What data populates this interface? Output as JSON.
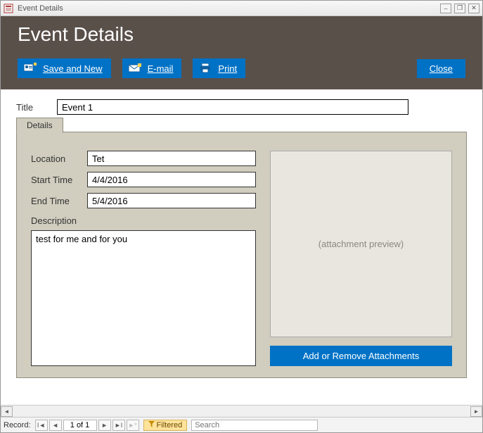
{
  "window": {
    "title": "Event Details",
    "controls": {
      "minimize": "–",
      "restore": "❐",
      "close": "✕"
    }
  },
  "header": {
    "heading": "Event Details",
    "buttons": {
      "save_and_new": "Save and New",
      "email": "E-mail",
      "print": "Print",
      "close": "Close"
    }
  },
  "form": {
    "title_label": "Title",
    "title_value": "Event 1",
    "tab_label": "Details",
    "location_label": "Location",
    "location_value": "Tet",
    "start_time_label": "Start Time",
    "start_time_value": "4/4/2016",
    "end_time_label": "End Time",
    "end_time_value": "5/4/2016",
    "description_label": "Description",
    "description_value": "test for me and for you",
    "attachment_preview_text": "(attachment preview)",
    "attachment_button": "Add or Remove Attachments"
  },
  "recordnav": {
    "label": "Record:",
    "position": "1 of 1",
    "filtered_label": "Filtered",
    "search_placeholder": "Search"
  }
}
